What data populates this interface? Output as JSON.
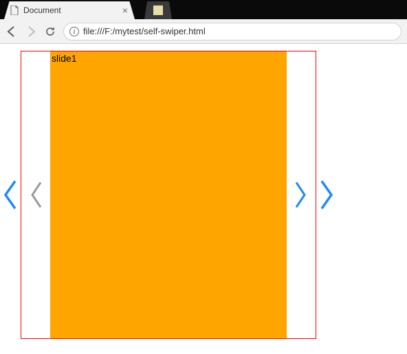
{
  "browser": {
    "tab_title": "Document",
    "close_glyph": "×",
    "url": "file:///F:/mytest/self-swiper.html",
    "info_glyph": "i"
  },
  "swiper": {
    "active_slide_label": "slide1"
  }
}
